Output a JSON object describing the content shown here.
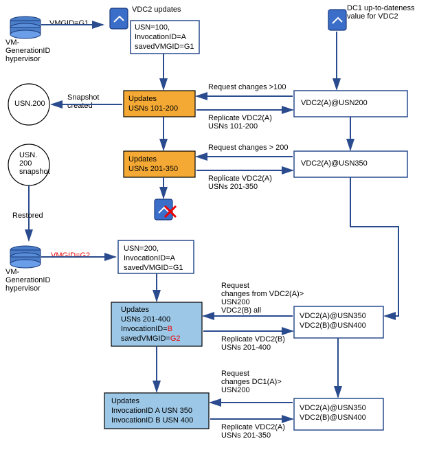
{
  "top": {
    "vdc2_updates": "VDC2 updates",
    "dc1_label1": "DC1 up-to-dateness",
    "dc1_label2": "value for VDC2",
    "vmgid1": "VMGID=G1",
    "hyp1_l1": "VM-",
    "hyp1_l2": "GenerationID",
    "hyp1_l3": "hypervisor",
    "box1_l1": "USN=100,",
    "box1_l2": "InvocationID=A",
    "box1_l3": "savedVMGID=G1"
  },
  "row2": {
    "usn200": "USN.200",
    "snap1": "Snapshot",
    "snap2": "created",
    "updates_l1": "Updates",
    "updates_l2": "USNs 101-200",
    "req": "Request changes >100",
    "rep_l1": "Replicate VDC2(A)",
    "rep_l2": "USNs 101-200",
    "right": "VDC2(A)@USN200"
  },
  "row3": {
    "snap_l1": "USN.",
    "snap_l2": "200",
    "snap_l3": "snapshot",
    "updates_l1": "Updates",
    "updates_l2": "USNs 201-350",
    "req": "Request changes > 200",
    "rep_l1": "Replicate VDC2(A)",
    "rep_l2": "USNs 201-350",
    "right": "VDC2(A)@USN350",
    "restored": "Restored"
  },
  "row4": {
    "hyp_l1": "VM-",
    "hyp_l2": "GenerationID",
    "hyp_l3": "hypervisor",
    "vmgid2": "VMGID=G2",
    "box_l1": "USN=200,",
    "box_l2": "InvocationID=A",
    "box_l3": "savedVMGID=G1"
  },
  "row5": {
    "upd_l1": "Updates",
    "upd_l2": "USNs 201-400",
    "upd_l3a": "InvocationID=",
    "upd_l3b": "B",
    "upd_l4a": "savedVMGID=",
    "upd_l4b": "G2",
    "req_l1": "Request",
    "req_l2": "changes from VDC2(A)>",
    "req_l3": "USN200",
    "req_l4": "VDC2(B) all",
    "rep_l1": "Replicate VDC2(B)",
    "rep_l2": "USNs 201-400",
    "right_l1": "VDC2(A)@USN350",
    "right_l2": "VDC2(B)@USN400"
  },
  "row6": {
    "upd_l1": "Updates",
    "upd_l2": "InvocationID A USN 350",
    "upd_l3": "InvocationID B USN 400",
    "req_l1": "Request",
    "req_l2": "changes DC1(A)>",
    "req_l3": "USN200",
    "rep_l1": "Replicate VDC2(A)",
    "rep_l2": "USNs 201-350",
    "right_l1": "VDC2(A)@USN350",
    "right_l2": "VDC2(B)@USN400"
  }
}
